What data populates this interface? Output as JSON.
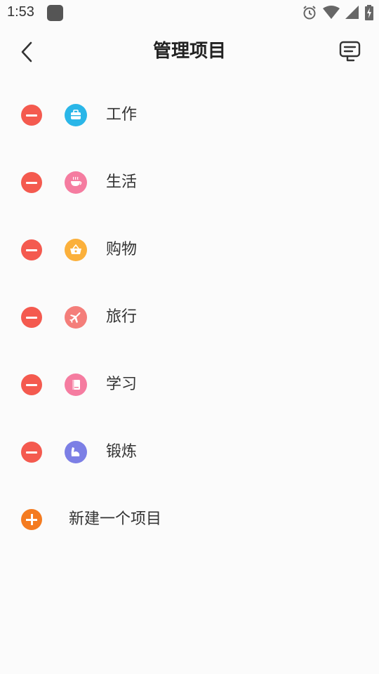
{
  "status_bar": {
    "time": "1:53",
    "icons": [
      "app-notification-icon",
      "alarm-icon",
      "wifi-icon",
      "signal-icon",
      "battery-charging-icon"
    ]
  },
  "header": {
    "title": "管理项目",
    "back_icon": "back-arrow-icon",
    "action_icon": "comment-icon"
  },
  "categories": [
    {
      "label": "工作",
      "icon": "briefcase-icon",
      "color": "#2ab6e8"
    },
    {
      "label": "生活",
      "icon": "coffee-cup-icon",
      "color": "#f57ca0"
    },
    {
      "label": "购物",
      "icon": "shopping-basket-icon",
      "color": "#fbb03b"
    },
    {
      "label": "旅行",
      "icon": "airplane-icon",
      "color": "#f47e7a"
    },
    {
      "label": "学习",
      "icon": "book-icon",
      "color": "#f57ca0"
    },
    {
      "label": "锻炼",
      "icon": "muscle-arm-icon",
      "color": "#7c7fe5"
    }
  ],
  "add_item": {
    "label": "新建一个项目",
    "icon": "add-circle-icon",
    "color": "#f47b20"
  },
  "colors": {
    "remove": "#f45a4f",
    "background": "#fbfbfb"
  }
}
